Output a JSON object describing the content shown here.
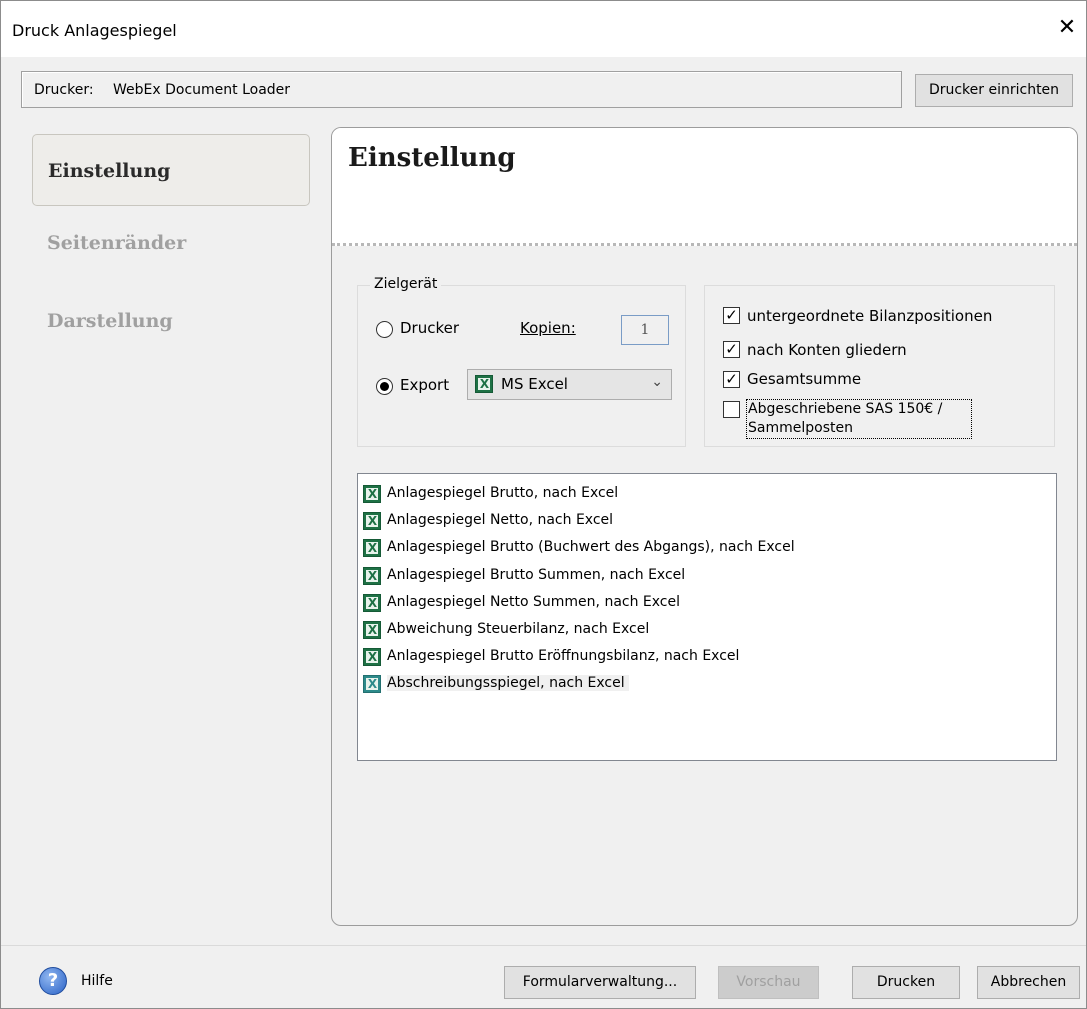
{
  "window": {
    "title": "Druck Anlagespiegel",
    "close_glyph": "✕"
  },
  "printer": {
    "label": "Drucker:",
    "name": "WebEx Document Loader",
    "setup_button": "Drucker einrichten"
  },
  "nav": {
    "items": [
      {
        "label": "Einstellung",
        "active": true
      },
      {
        "label": "Seitenränder",
        "active": false
      },
      {
        "label": "Darstellung",
        "active": false
      }
    ]
  },
  "content": {
    "title": "Einstellung",
    "target_group": {
      "legend": "Zielgerät",
      "printer_option": "Drucker",
      "copies_label": "Kopien:",
      "copies_value": "1",
      "export_option": "Export",
      "export_format": "MS Excel",
      "selected": "export"
    },
    "options": [
      {
        "label": "untergeordnete Bilanzpositionen",
        "checked": true
      },
      {
        "label": "nach Konten gliedern",
        "checked": true
      },
      {
        "label": "Gesamtsumme",
        "checked": true
      },
      {
        "label": "Abgeschriebene SAS 150€ /",
        "label2": "Sammelposten",
        "checked": false
      }
    ],
    "forms": [
      "Anlagespiegel Brutto, nach Excel",
      "Anlagespiegel Netto, nach Excel",
      "Anlagespiegel Brutto (Buchwert des Abgangs), nach Excel",
      "Anlagespiegel Brutto Summen, nach Excel",
      "Anlagespiegel Netto Summen, nach Excel",
      "Abweichung Steuerbilanz, nach Excel",
      "Anlagespiegel Brutto Eröffnungsbilanz, nach Excel",
      "Abschreibungsspiegel, nach Excel"
    ],
    "selected_form_index": 7
  },
  "footer": {
    "help_label": "Hilfe",
    "help_glyph": "?",
    "form_manager_button": "Formularverwaltung...",
    "preview_button": "Vorschau",
    "print_button": "Drucken",
    "cancel_button": "Abbrechen"
  },
  "colors": {
    "excel_green": "#1e7145",
    "panel_bg": "#f0f0f0"
  }
}
